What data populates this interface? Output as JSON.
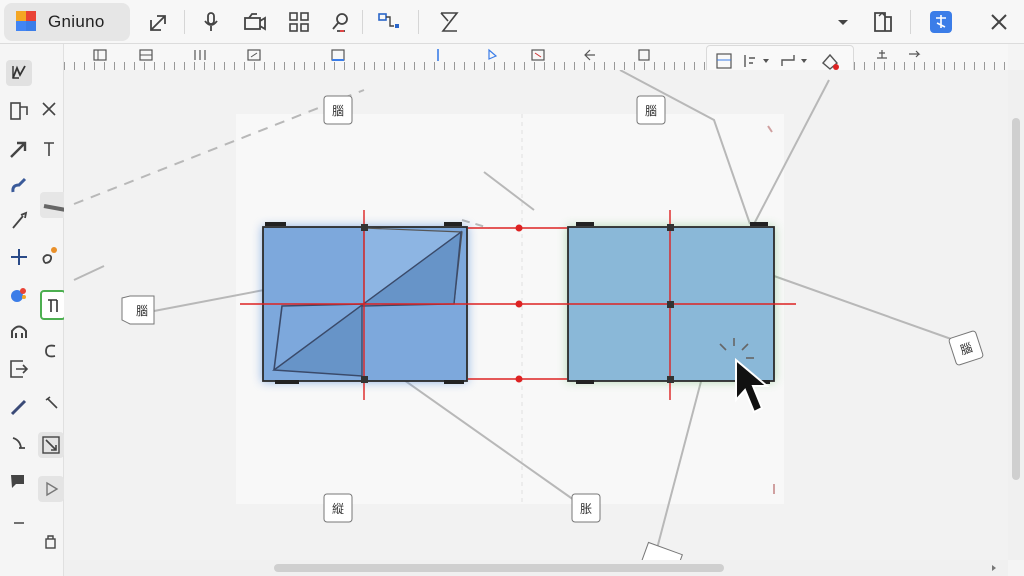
{
  "app": {
    "title": "Gniuno"
  },
  "labels": {
    "top_left": "腦",
    "top_mid": "腦",
    "left": "腦",
    "right": "腦",
    "bottom_left": "縦",
    "bottom_mid": "胀"
  },
  "icons": {
    "toolbar": [
      "pop-out-icon",
      "microphone-icon",
      "camera-icon",
      "grid-icon",
      "search-person-icon",
      "connector-icon",
      "hourglass-icon",
      "dropdown-caret-icon",
      "share-icon",
      "app-badge-icon",
      "close-icon"
    ],
    "palette": [
      "select-icon",
      "crop-icon",
      "arrow-icon",
      "text-icon",
      "brush-icon",
      "shape-icon",
      "pen-icon",
      "scissors-icon",
      "plus-icon",
      "paint-icon",
      "node-icon",
      "frame-icon",
      "person-icon",
      "curve-icon",
      "export-icon",
      "pencil-icon",
      "hammer-icon",
      "eraser-icon",
      "resize-icon",
      "comment-icon",
      "play-icon",
      "minus-icon",
      "lock-icon"
    ]
  },
  "colors": {
    "shape_blue": "#7da8dc",
    "shape_teal": "#8ab8d8",
    "guide_red": "#dd2222",
    "select_glow": "#3a7bd5",
    "select_glow_green": "#4caf50"
  }
}
